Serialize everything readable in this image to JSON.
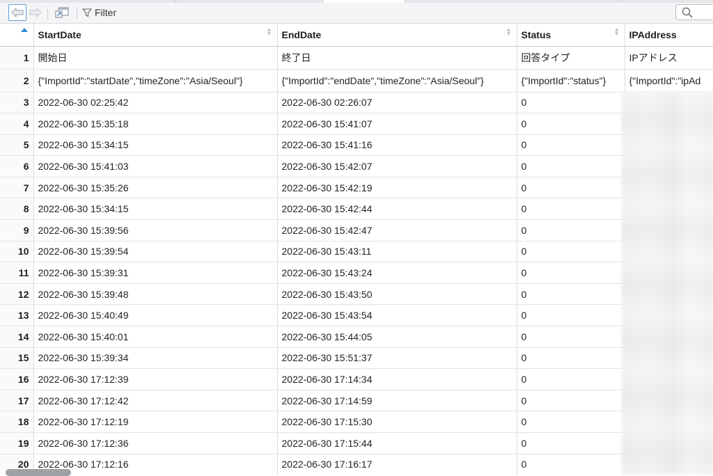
{
  "toolbar": {
    "filter_label": "Filter",
    "back_icon": "arrow-left-icon",
    "forward_icon": "arrow-right-icon",
    "popout_icon": "popout-window-icon",
    "filter_icon": "funnel-icon",
    "search_icon": "search-icon"
  },
  "columns": [
    "StartDate",
    "EndDate",
    "Status",
    "IPAddress"
  ],
  "rows": [
    {
      "n": "1",
      "start": "開始日",
      "end": "終了日",
      "status": "回答タイプ",
      "ip": "IPアドレス"
    },
    {
      "n": "2",
      "start": "{\"ImportId\":\"startDate\",\"timeZone\":\"Asia/Seoul\"}",
      "end": "{\"ImportId\":\"endDate\",\"timeZone\":\"Asia/Seoul\"}",
      "status": "{\"ImportId\":\"status\"}",
      "ip": "{\"ImportId\":\"ipAd"
    },
    {
      "n": "3",
      "start": "2022-06-30 02:25:42",
      "end": "2022-06-30 02:26:07",
      "status": "0",
      "ip": ""
    },
    {
      "n": "4",
      "start": "2022-06-30 15:35:18",
      "end": "2022-06-30 15:41:07",
      "status": "0",
      "ip": ""
    },
    {
      "n": "5",
      "start": "2022-06-30 15:34:15",
      "end": "2022-06-30 15:41:16",
      "status": "0",
      "ip": ""
    },
    {
      "n": "6",
      "start": "2022-06-30 15:41:03",
      "end": "2022-06-30 15:42:07",
      "status": "0",
      "ip": ""
    },
    {
      "n": "7",
      "start": "2022-06-30 15:35:26",
      "end": "2022-06-30 15:42:19",
      "status": "0",
      "ip": ""
    },
    {
      "n": "8",
      "start": "2022-06-30 15:34:15",
      "end": "2022-06-30 15:42:44",
      "status": "0",
      "ip": ""
    },
    {
      "n": "9",
      "start": "2022-06-30 15:39:56",
      "end": "2022-06-30 15:42:47",
      "status": "0",
      "ip": ""
    },
    {
      "n": "10",
      "start": "2022-06-30 15:39:54",
      "end": "2022-06-30 15:43:11",
      "status": "0",
      "ip": ""
    },
    {
      "n": "11",
      "start": "2022-06-30 15:39:31",
      "end": "2022-06-30 15:43:24",
      "status": "0",
      "ip": ""
    },
    {
      "n": "12",
      "start": "2022-06-30 15:39:48",
      "end": "2022-06-30 15:43:50",
      "status": "0",
      "ip": ""
    },
    {
      "n": "13",
      "start": "2022-06-30 15:40:49",
      "end": "2022-06-30 15:43:54",
      "status": "0",
      "ip": ""
    },
    {
      "n": "14",
      "start": "2022-06-30 15:40:01",
      "end": "2022-06-30 15:44:05",
      "status": "0",
      "ip": ""
    },
    {
      "n": "15",
      "start": "2022-06-30 15:39:34",
      "end": "2022-06-30 15:51:37",
      "status": "0",
      "ip": ""
    },
    {
      "n": "16",
      "start": "2022-06-30 17:12:39",
      "end": "2022-06-30 17:14:34",
      "status": "0",
      "ip": ""
    },
    {
      "n": "17",
      "start": "2022-06-30 17:12:42",
      "end": "2022-06-30 17:14:59",
      "status": "0",
      "ip": ""
    },
    {
      "n": "18",
      "start": "2022-06-30 17:12:19",
      "end": "2022-06-30 17:15:30",
      "status": "0",
      "ip": ""
    },
    {
      "n": "19",
      "start": "2022-06-30 17:12:36",
      "end": "2022-06-30 17:15:44",
      "status": "0",
      "ip": ""
    },
    {
      "n": "20",
      "start": "2022-06-30 17:12:16",
      "end": "2022-06-30 17:16:17",
      "status": "0",
      "ip": ""
    }
  ]
}
